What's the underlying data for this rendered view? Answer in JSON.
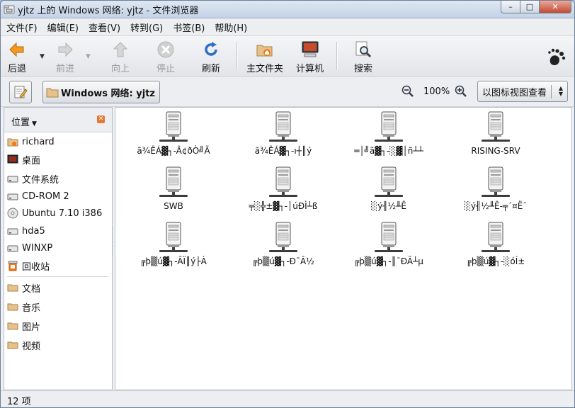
{
  "window": {
    "title": "yjtz 上的 Windows 网络: yjtz - 文件浏览器",
    "min_symbol": "–",
    "max_symbol": "□",
    "close_symbol": "✕"
  },
  "menu": [
    "文件(F)",
    "编辑(E)",
    "查看(V)",
    "转到(G)",
    "书签(B)",
    "帮助(H)"
  ],
  "toolbar": {
    "back": "后退",
    "forward": "前进",
    "up": "向上",
    "stop": "停止",
    "reload": "刷新",
    "home": "主文件夹",
    "computer": "计算机",
    "search": "搜索"
  },
  "location": {
    "path_label": "Windows 网络: yjtz",
    "zoom": "100%",
    "view_mode": "以图标视图查看"
  },
  "sidebar": {
    "header": "位置",
    "items": [
      {
        "label": "richard",
        "icon": "home-folder-icon"
      },
      {
        "label": "桌面",
        "icon": "desktop-icon"
      },
      {
        "label": "文件系统",
        "icon": "drive-icon"
      },
      {
        "label": "CD-ROM 2",
        "icon": "drive-icon"
      },
      {
        "label": "Ubuntu 7.10 i386",
        "icon": "cdrom-icon"
      },
      {
        "label": "hda5",
        "icon": "drive-icon"
      },
      {
        "label": "WINXP",
        "icon": "drive-icon"
      },
      {
        "label": "回收站",
        "icon": "trash-icon"
      }
    ],
    "bookmarks": [
      {
        "label": "文档",
        "icon": "folder-icon"
      },
      {
        "label": "音乐",
        "icon": "folder-icon"
      },
      {
        "label": "图片",
        "icon": "folder-icon"
      },
      {
        "label": "视频",
        "icon": "folder-icon"
      }
    ]
  },
  "files": [
    "ã¾ÊÁ▓┐-Â¢ðÒ╝Ã",
    "ã¾ÊÁ▓┐-ı┼║ý",
    "═│╝ã▓┐-░▓│ñ┴┴",
    "RISING-SRV",
    "SWB",
    "╤░╬±▓┐-│úÐÌ┴ß",
    "░ý╢½╨Ê",
    "░ý╢½╨Ê-╤´¤Ë¯",
    "╔þ▒ú▓┐-ÃÏ║ý├À",
    "╔þ▒ú▓┐-Ð¯Â½",
    "╔þ▒ú▓┐-║¯ÐÃ┴µ",
    "╔þ▒ú▓┐-░óÍ±"
  ],
  "status": "12 项"
}
